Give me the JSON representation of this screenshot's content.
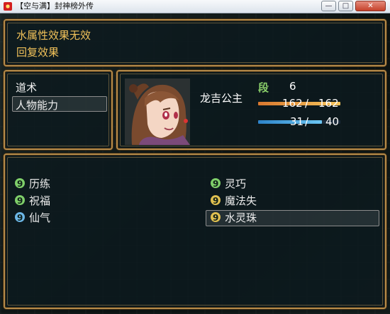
{
  "window": {
    "title": "【空与满】封神榜外传",
    "min_symbol": "—",
    "max_symbol": "□",
    "close_symbol": "✕"
  },
  "help": {
    "line1": "水属性效果无效",
    "line2": "回复效果"
  },
  "command_menu": {
    "items": [
      "道术",
      "人物能力"
    ],
    "selected_index": 1
  },
  "status": {
    "name": "龙吉公主",
    "level_label": "段",
    "level": "6",
    "hp_current": "162",
    "hp_max": "162",
    "hp_separator": "/",
    "hp_fill": 1.0,
    "mp_current": "31",
    "mp_max": "40",
    "mp_separator": "/",
    "mp_fill": 0.775,
    "colors": {
      "hp": "#e8933e",
      "mp": "#4aa6e0",
      "level_label": "#8bd06a"
    }
  },
  "skills": {
    "left": [
      {
        "label": "历练",
        "icon": "green-skill-orb-icon",
        "color": "#7fcf6a"
      },
      {
        "label": "祝福",
        "icon": "green-skill-orb-icon",
        "color": "#7fcf6a"
      },
      {
        "label": "仙气",
        "icon": "blue-skill-orb-icon",
        "color": "#6cb6e6"
      }
    ],
    "right": [
      {
        "label": "灵巧",
        "icon": "green-skill-orb-icon",
        "color": "#7fcf6a"
      },
      {
        "label": "魔法失",
        "icon": "gold-skill-orb-icon",
        "color": "#e0c050"
      },
      {
        "label": "水灵珠",
        "icon": "gold-skill-orb-icon",
        "color": "#e0c050"
      }
    ],
    "icon_glyph": "9",
    "selected": "水灵珠"
  }
}
